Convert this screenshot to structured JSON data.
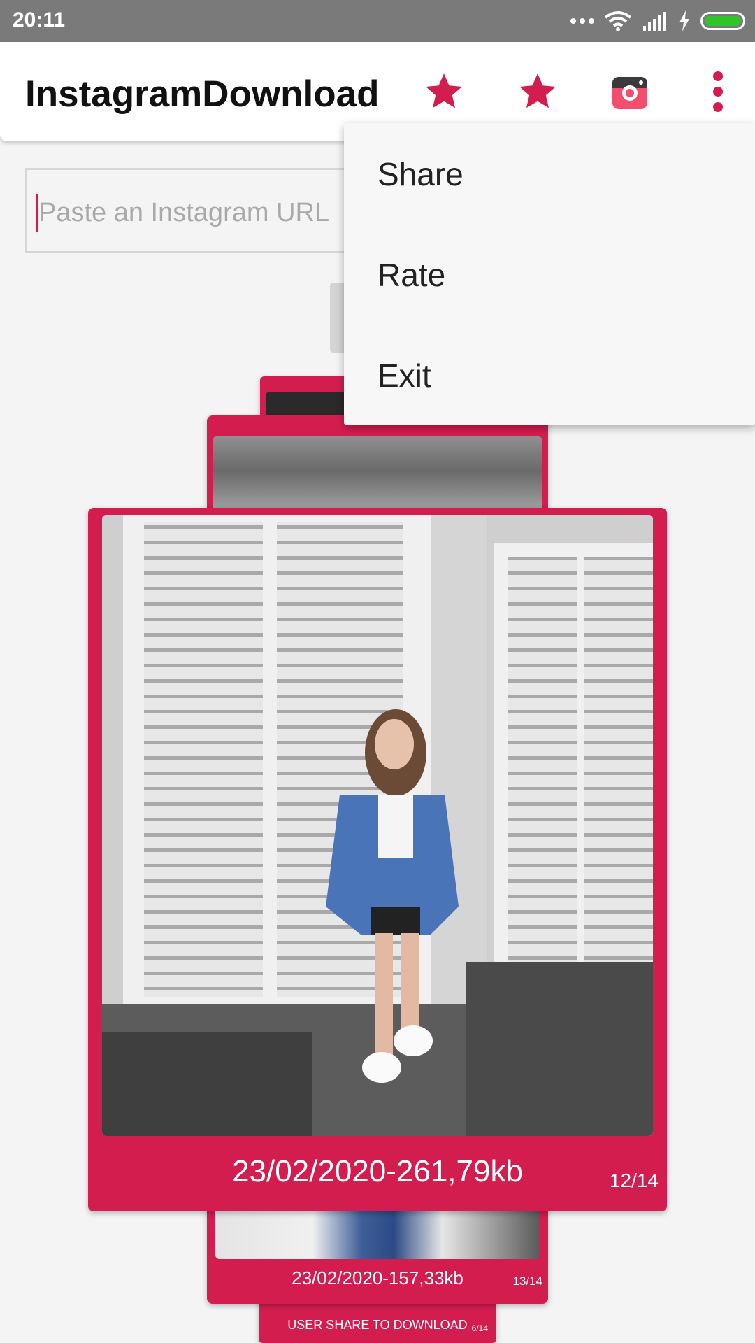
{
  "status_bar": {
    "time": "20:11"
  },
  "app_bar": {
    "title": "InstagramDownload",
    "icons": [
      "star-icon",
      "star-icon",
      "camera-app-icon",
      "more-vert-icon"
    ]
  },
  "url_input": {
    "placeholder": "Paste an Instagram URL"
  },
  "cards": {
    "main": {
      "caption": "23/02/2020-261,79kb",
      "counter": "12/14"
    },
    "below": {
      "caption": "23/02/2020-157,33kb",
      "counter": "13/14"
    },
    "bottom": {
      "caption": "USER SHARE TO DOWNLOAD",
      "counter": "6/14"
    }
  },
  "menu": {
    "items": [
      "Share",
      "Rate",
      "Exit"
    ]
  },
  "colors": {
    "accent": "#d31d4f",
    "status_bar": "#7a7a7a",
    "battery": "#32c32a"
  }
}
